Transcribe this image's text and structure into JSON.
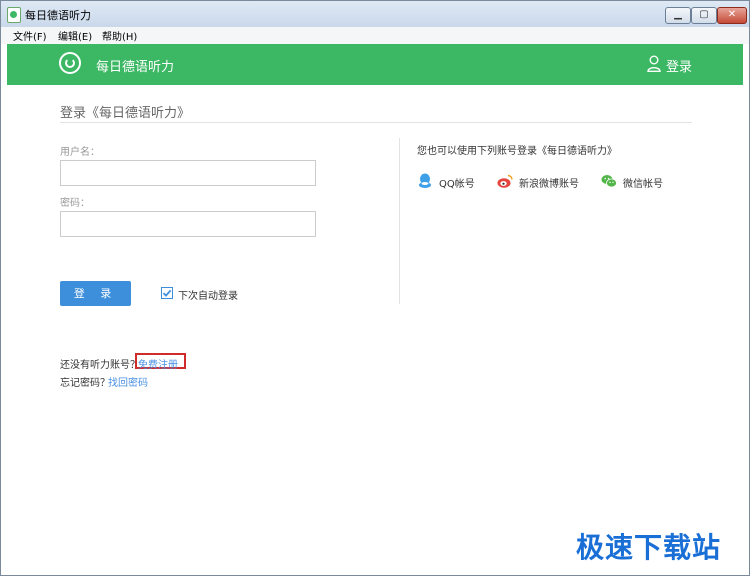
{
  "window": {
    "title": "每日德语听力",
    "buttons": {
      "minimize": "▁",
      "maximize": "▢",
      "close": "✕"
    }
  },
  "menubar": {
    "items": [
      {
        "label": "文件(F)"
      },
      {
        "label": "编辑(E)"
      },
      {
        "label": "帮助(H)"
      }
    ]
  },
  "header": {
    "app_name": "每日德语听力",
    "login_label": "登录",
    "icons": {
      "logo": "logo-icon",
      "user": "user-icon"
    },
    "background_color": "#3cb864"
  },
  "login_form": {
    "heading": "登录《每日德语听力》",
    "username_label": "用户名：",
    "username_value": "",
    "password_label": "密码：",
    "password_value": "",
    "submit_label": "登 录",
    "remember_label": "下次自动登录",
    "remember_checked": true,
    "accent_color": "#3d8fdc"
  },
  "third_party": {
    "title": "您也可以使用下列账号登录《每日德语听力》",
    "options": [
      {
        "label": "QQ帐号",
        "icon": "qq-icon",
        "color": "#3fa0e8"
      },
      {
        "label": "新浪微博账号",
        "icon": "weibo-icon",
        "color": "#e5443c"
      },
      {
        "label": "微信帐号",
        "icon": "wechat-icon",
        "color": "#52b548"
      }
    ]
  },
  "footer_links": {
    "no_account_text": "还没有听力账号？",
    "register_link": "免费注册",
    "forgot_text": "忘记密码？",
    "forgot_link": "找回密码",
    "link_color": "#4a90e2"
  },
  "watermark": {
    "text": "极速下载站"
  }
}
